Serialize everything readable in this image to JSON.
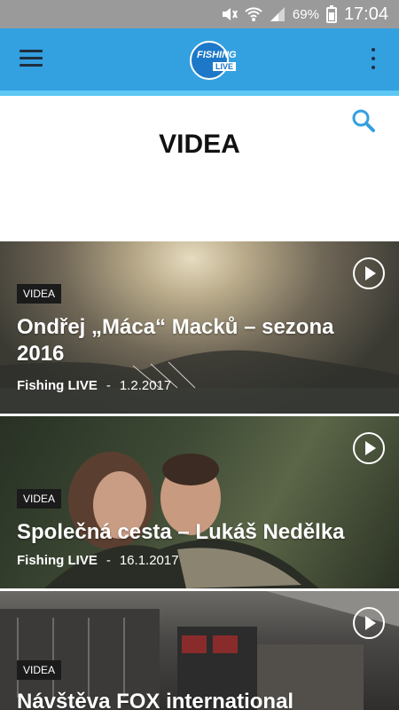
{
  "status_bar": {
    "battery": "69%",
    "time": "17:04"
  },
  "app_bar": {
    "logo_top": "FISHING",
    "logo_bottom": "LIVE",
    "accent": "#33a0e0"
  },
  "page": {
    "title": "VIDEA"
  },
  "cards": [
    {
      "badge": "VIDEA",
      "title": "Ondřej „Máca“ Macků – sezona 2016",
      "author": "Fishing LIVE",
      "date": "1.2.2017"
    },
    {
      "badge": "VIDEA",
      "title": "Společná cesta – Lukáš Nedělka",
      "author": "Fishing LIVE",
      "date": "16.1.2017"
    },
    {
      "badge": "VIDEA",
      "title": "Návštěva FOX international"
    }
  ]
}
